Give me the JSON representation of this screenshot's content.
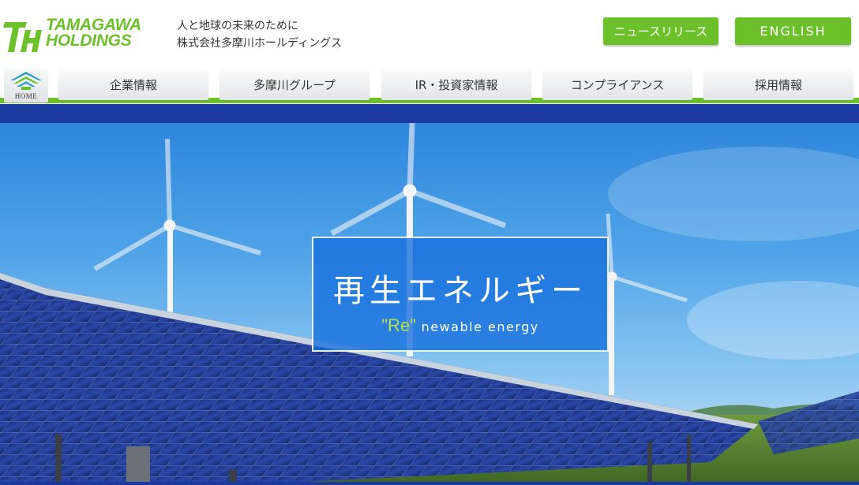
{
  "header": {
    "logo": {
      "mark": "TH",
      "line1": "TAMAGAWA",
      "line2": "HOLDINGS"
    },
    "tagline": {
      "line1": "人と地球の未来のために",
      "line2": "株式会社多摩川ホールディングス"
    },
    "buttons": {
      "news": "ニュースリリース",
      "english": "ENGLISH"
    }
  },
  "nav": {
    "home_label": "HOME",
    "items": [
      {
        "label": "企業情報"
      },
      {
        "label": "多摩川グループ"
      },
      {
        "label": "IR・投資家情報"
      },
      {
        "label": "コンプライアンス"
      },
      {
        "label": "採用情報"
      }
    ]
  },
  "hero": {
    "title": "再生エネルギー",
    "sub_accent": "\"Re\"",
    "sub_rest": " newable energy"
  },
  "colors": {
    "brand_green": "#6cc12a",
    "band_blue": "#1a3aa0",
    "hero_box": "#146edc"
  },
  "icons": {
    "home": "home-icon"
  }
}
